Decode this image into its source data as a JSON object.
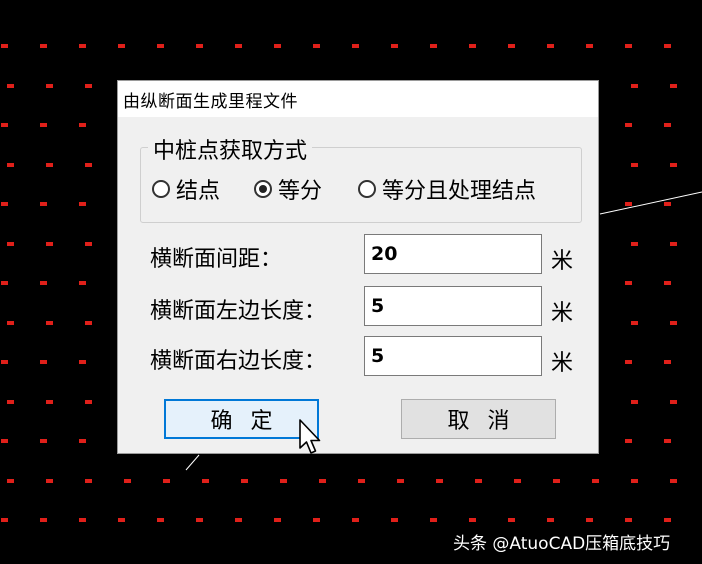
{
  "background": {
    "color": "#000000",
    "dot_color": "#e0201a",
    "line_color": "#ffffff"
  },
  "dialog": {
    "title": "由纵断面生成里程文件",
    "group": {
      "title": "中桩点获取方式",
      "options": [
        {
          "label": "结点",
          "checked": false
        },
        {
          "label": "等分",
          "checked": true
        },
        {
          "label": "等分且处理结点",
          "checked": false
        }
      ]
    },
    "fields": [
      {
        "label": "横断面间距：",
        "value": "20",
        "unit": "米"
      },
      {
        "label": "横断面左边长度：",
        "value": "5",
        "unit": "米"
      },
      {
        "label": "横断面右边长度：",
        "value": "5",
        "unit": "米"
      }
    ],
    "buttons": {
      "ok": "确定",
      "cancel": "取消"
    }
  },
  "cursor_icon": "mouse-pointer-icon",
  "watermark": "头条 @AtuoCAD压箱底技巧"
}
